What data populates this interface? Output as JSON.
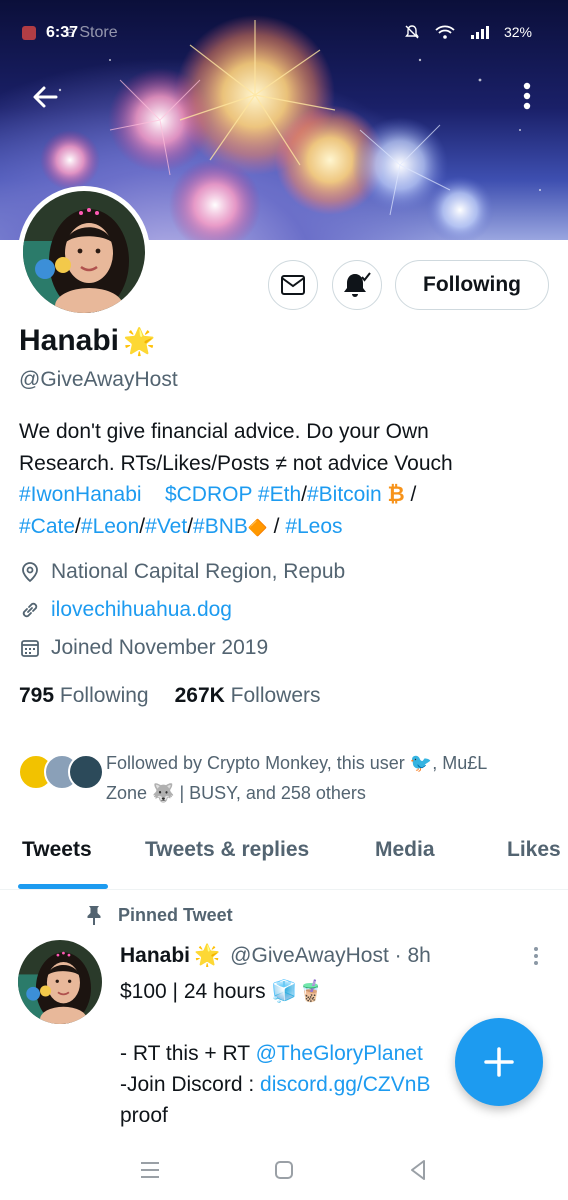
{
  "status_bar": {
    "time": "6:37",
    "ghost_text": "e  Store",
    "battery": "32%"
  },
  "profile": {
    "name": "Hanabi",
    "name_emoji": "🌟",
    "handle": "@GiveAwayHost",
    "following_button_label": "Following",
    "bio": {
      "line1": "We don't give financial advice. Do your Own",
      "line2": "Research. RTs/Likes/Posts ≠ not advice   Vouch",
      "line3_a": "#IwonHanabi",
      "line3_b": "$CDROP",
      "line3_c": "#Eth",
      "line3_sep1": "/",
      "line3_d": "#Bitcoin",
      "line3_emoji": "₿",
      "line3_sep2": " /",
      "line4_a": "#Cate",
      "line4_b": "#Leon",
      "line4_c": "#Vet",
      "line4_d": "#BNB",
      "line4_emoji": "🔶",
      "line4_sep": " / ",
      "line4_e": "#Leos",
      "slash": "/"
    },
    "location": "National Capital Region, Repub",
    "website": "ilovechihuahua.dog",
    "joined": "Joined November 2019",
    "following_count": "795",
    "following_label": "Following",
    "followers_count": "267K",
    "followers_label": "Followers",
    "followed_by_line1": "Followed by Crypto Monkey, this user 🐦, Mu£L",
    "followed_by_line2": "Zone 🐺 | BUSY, and 258 others"
  },
  "tabs": [
    {
      "label": "Tweets"
    },
    {
      "label": "Tweets & replies"
    },
    {
      "label": "Media"
    },
    {
      "label": "Likes"
    }
  ],
  "pinned_label": "Pinned Tweet",
  "tweet": {
    "name": "Hanabi",
    "name_emoji": "🌟",
    "handle_time": "@GiveAwayHost · 8h",
    "line1": "$100 | 24 hours 🧊🧋",
    "line2": "",
    "line3_prefix": "- RT this + RT ",
    "line3_link": "@TheGloryPlanet",
    "line4_prefix": "-Join Discord : ",
    "line4_link": "discord.gg/CZVnB",
    "line5": "proof"
  },
  "colors": {
    "accent": "#1d9bf0",
    "text_primary": "#0f1419",
    "text_secondary": "#536471"
  }
}
